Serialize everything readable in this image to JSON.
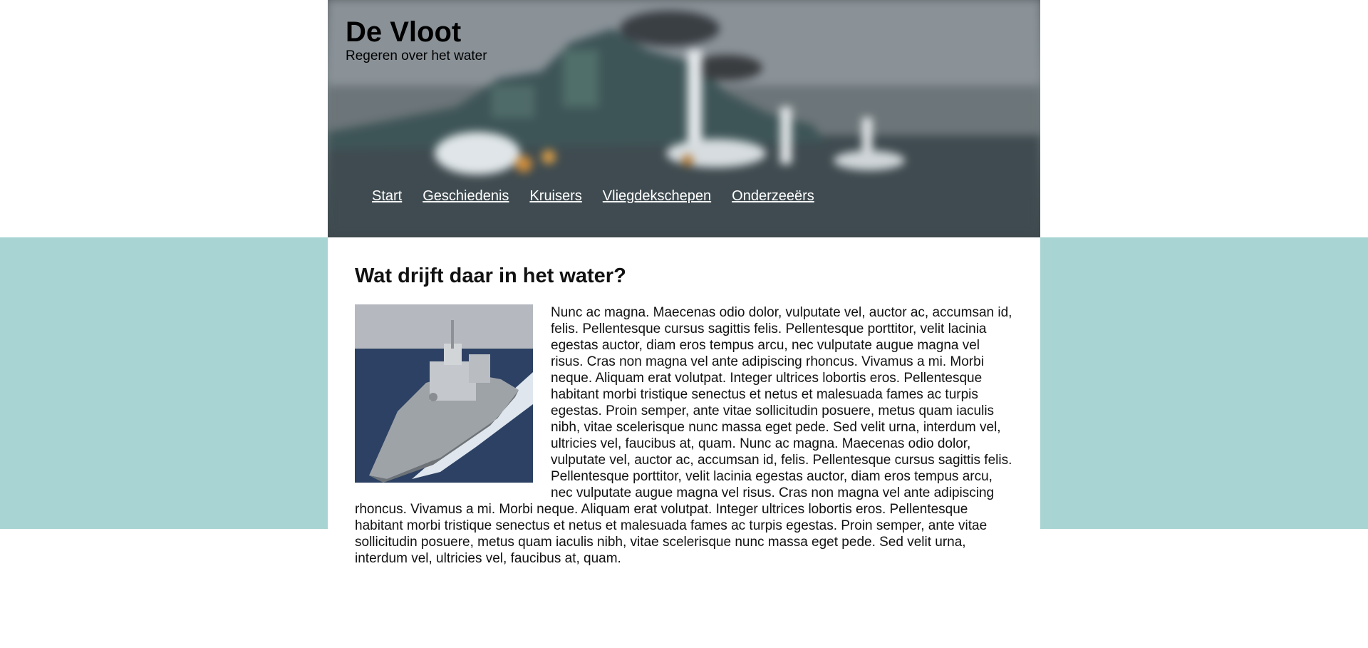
{
  "header": {
    "title": "De Vloot",
    "subtitle": "Regeren over het water"
  },
  "nav": {
    "items": [
      "Start",
      "Geschiedenis",
      "Kruisers",
      "Vliegdekschepen",
      "Onderzeeërs"
    ]
  },
  "main": {
    "heading": "Wat drijft daar in het water?",
    "paragraph": "Nunc ac magna. Maecenas odio dolor, vulputate vel, auctor ac, accumsan id, felis. Pellentesque cursus sagittis felis. Pellentesque porttitor, velit lacinia egestas auctor, diam eros tempus arcu, nec vulputate augue magna vel risus. Cras non magna vel ante adipiscing rhoncus. Vivamus a mi. Morbi neque. Aliquam erat volutpat. Integer ultrices lobortis eros. Pellentesque habitant morbi tristique senectus et netus et malesuada fames ac turpis egestas. Proin semper, ante vitae sollicitudin posuere, metus quam iaculis nibh, vitae scelerisque nunc massa eget pede. Sed velit urna, interdum vel, ultricies vel, faucibus at, quam. Nunc ac magna. Maecenas odio dolor, vulputate vel, auctor ac, accumsan id, felis. Pellentesque cursus sagittis felis. Pellentesque porttitor, velit lacinia egestas auctor, diam eros tempus arcu, nec vulputate augue magna vel risus. Cras non magna vel ante adipiscing rhoncus. Vivamus a mi. Morbi neque. Aliquam erat volutpat. Integer ultrices lobortis eros. Pellentesque habitant morbi tristique senectus et netus et malesuada fames ac turpis egestas. Proin semper, ante vitae sollicitudin posuere, metus quam iaculis nibh, vitae scelerisque nunc massa eget pede. Sed velit urna, interdum vel, ultricies vel, faucibus at, quam."
  },
  "colors": {
    "band": "#a8d5d3",
    "nav_link": "#ffffff",
    "text": "#111111"
  }
}
